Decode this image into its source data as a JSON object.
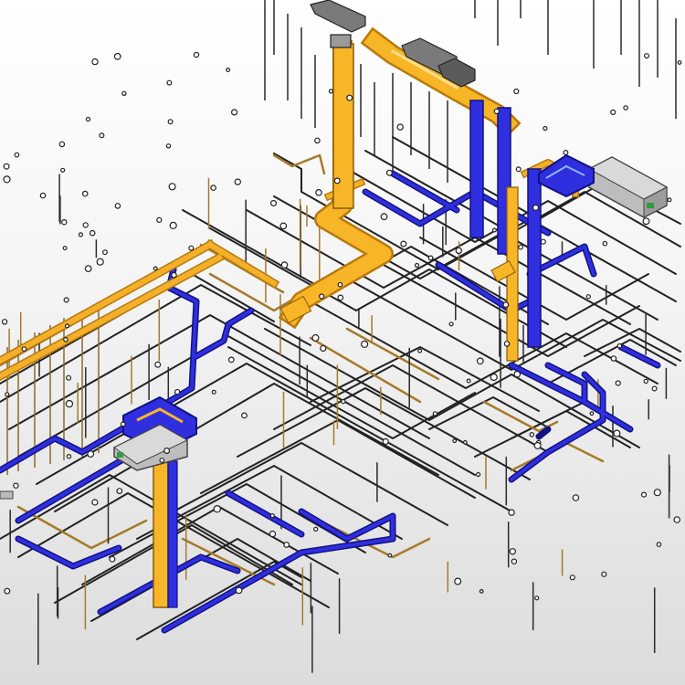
{
  "scene": {
    "description_label": "",
    "colors": {
      "background_top": "#ffffff",
      "background_bottom": "#d9d9d9",
      "supply_duct": "#f4b02a",
      "supply_duct_dark": "#b9790b",
      "return_duct": "#2a2ad6",
      "return_duct_dark": "#121280",
      "pipe": "#222222",
      "pipe_alt": "#8a6a2a",
      "equipment": "#bdbdbd",
      "equipment_dark": "#6b6b6b",
      "indicator": "#2e9e3e"
    },
    "equipment": [
      {
        "name": "air-handling-unit-east"
      },
      {
        "name": "air-handling-unit-west"
      },
      {
        "name": "rooftop-units-north"
      }
    ],
    "icons": [
      "hanger-rod-icon",
      "duct-fitting-icon"
    ]
  }
}
